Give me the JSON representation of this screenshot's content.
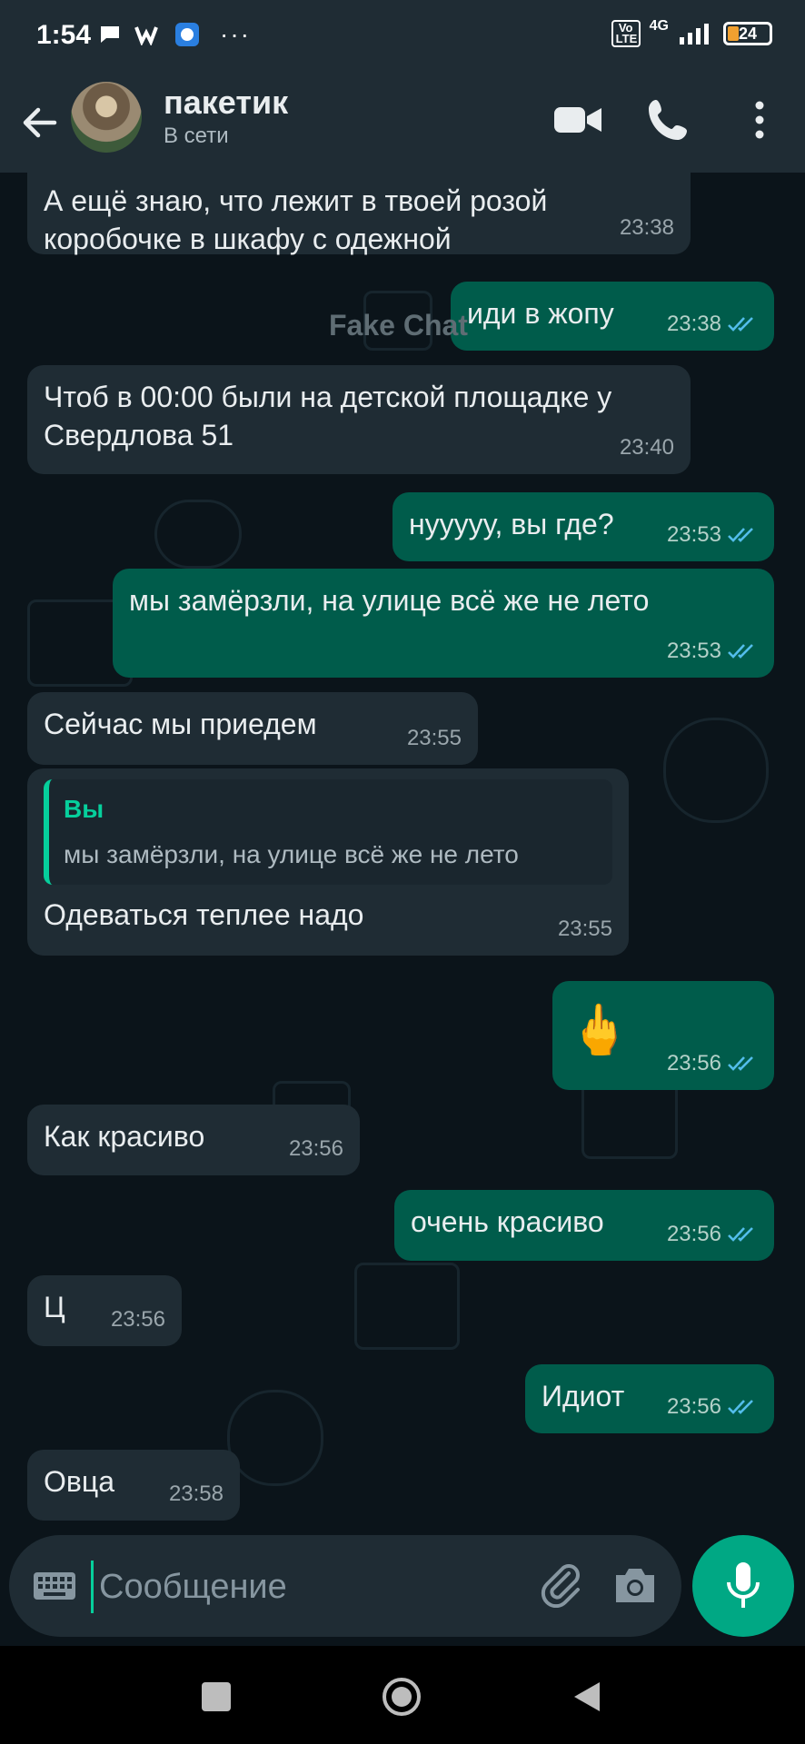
{
  "status_bar": {
    "time": "1:54",
    "more": "···",
    "network": "4G",
    "volte": "Vo LTE",
    "battery": "24"
  },
  "header": {
    "contact_name": "пакетик",
    "status": "В сети"
  },
  "watermark": "Fake Chat",
  "messages": [
    {
      "dir": "in",
      "text": "А ещё знаю, что лежит в твоей розой коробочке в шкафу с одежной",
      "time": "23:38"
    },
    {
      "dir": "out",
      "text": "иди в жопу",
      "time": "23:38"
    },
    {
      "dir": "in",
      "text": "Чтоб в 00:00 были на детской площадке у Свердлова 51",
      "time": "23:40"
    },
    {
      "dir": "out",
      "text": "нууууу, вы где?",
      "time": "23:53"
    },
    {
      "dir": "out",
      "text": "мы замёрзли, на улице всё же не лето",
      "time": "23:53"
    },
    {
      "dir": "in",
      "text": "Сейчас мы приедем",
      "time": "23:55"
    },
    {
      "dir": "in",
      "text": "Одеваться теплее надо",
      "time": "23:55",
      "reply": {
        "author": "Вы",
        "text": "мы замёрзли, на улице всё же не лето"
      }
    },
    {
      "dir": "out",
      "text": "🖕",
      "time": "23:56"
    },
    {
      "dir": "in",
      "text": "Как красиво",
      "time": "23:56"
    },
    {
      "dir": "out",
      "text": "очень красиво",
      "time": "23:56"
    },
    {
      "dir": "in",
      "text": "Ц",
      "time": "23:56"
    },
    {
      "dir": "out",
      "text": "Идиот",
      "time": "23:56"
    },
    {
      "dir": "in",
      "text": "Овца",
      "time": "23:58"
    }
  ],
  "composer": {
    "placeholder": "Сообщение"
  },
  "colors": {
    "background": "#0b141a",
    "incoming": "#1f2c34",
    "outgoing": "#005c4b",
    "accent": "#00a884",
    "read_ticks": "#53bdeb"
  },
  "icons": [
    "back-arrow-icon",
    "video-call-icon",
    "phone-icon",
    "more-vert-icon",
    "keyboard-icon",
    "attach-icon",
    "camera-icon",
    "mic-icon",
    "square-nav-icon",
    "circle-nav-icon",
    "triangle-back-icon"
  ]
}
